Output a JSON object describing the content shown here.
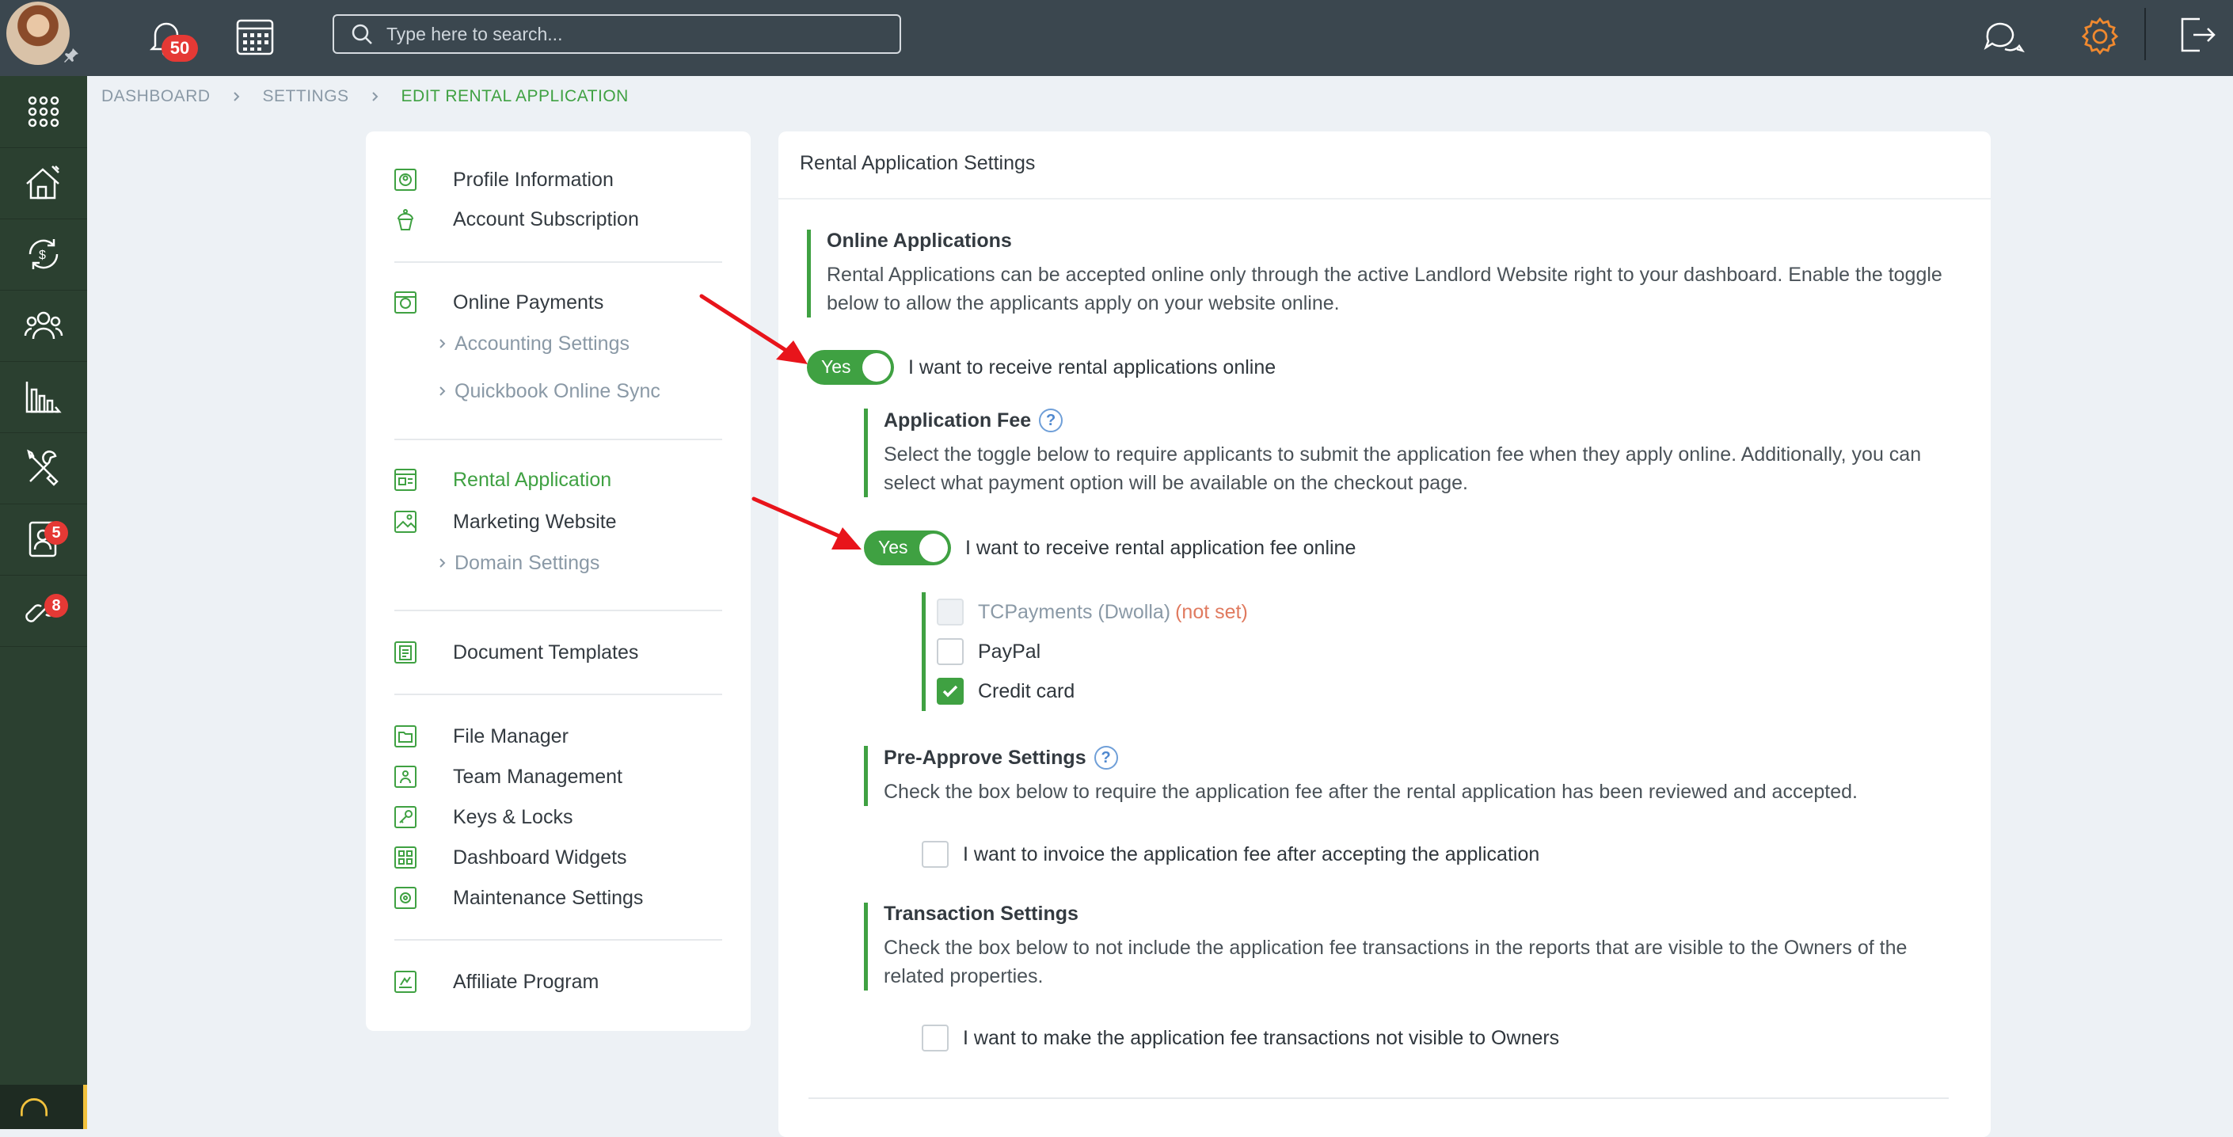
{
  "topbar": {
    "notification_count": "50",
    "search_placeholder": "Type here to search..."
  },
  "rail": {
    "badges": {
      "applications": "5",
      "affiliate": "8"
    }
  },
  "breadcrumb": {
    "items": [
      "DASHBOARD",
      "SETTINGS",
      "EDIT RENTAL APPLICATION"
    ]
  },
  "menu": {
    "items": [
      "Profile Information",
      "Account Subscription",
      "Online Payments",
      "Accounting Settings",
      "Quickbook Online Sync",
      "Rental Application",
      "Marketing Website",
      "Domain Settings",
      "Document Templates",
      "File Manager",
      "Team Management",
      "Keys & Locks",
      "Dashboard Widgets",
      "Maintenance Settings",
      "Affiliate Program"
    ]
  },
  "panel": {
    "title": "Rental Application Settings",
    "online": {
      "heading": "Online Applications",
      "text": "Rental Applications can be accepted online only through the active Landlord Website right to your dashboard. Enable the toggle below to allow the applicants apply on your website online.",
      "toggle_label": "Yes",
      "toggle_text": "I want to receive rental applications online"
    },
    "fee": {
      "heading": "Application Fee",
      "help": "?",
      "text": "Select the toggle below to require applicants to submit the application fee when they apply online. Additionally, you can select what payment option will be available on the checkout page.",
      "toggle_label": "Yes",
      "toggle_text": "I want to receive rental application fee online",
      "options": [
        {
          "label": "TCPayments (Dwolla)",
          "note": "(not set)",
          "state": "disabled"
        },
        {
          "label": "PayPal",
          "state": "unchecked"
        },
        {
          "label": "Credit card",
          "state": "checked"
        }
      ]
    },
    "preapprove": {
      "heading": "Pre-Approve Settings",
      "help": "?",
      "text": "Check the box below to require the application fee after the rental application has been reviewed and accepted.",
      "check_text": "I want to invoice the application fee after accepting the application"
    },
    "transaction": {
      "heading": "Transaction Settings",
      "text": "Check the box below to not include the application fee transactions in the reports that are visible to the Owners of the related properties.",
      "check_text": "I want to make the application fee transactions not visible to Owners"
    }
  },
  "colors": {
    "accent": "#3fa142",
    "rail": "#2b4030",
    "topbar": "#3b474f",
    "badge": "#e53935",
    "arrow": "#e8141b"
  }
}
